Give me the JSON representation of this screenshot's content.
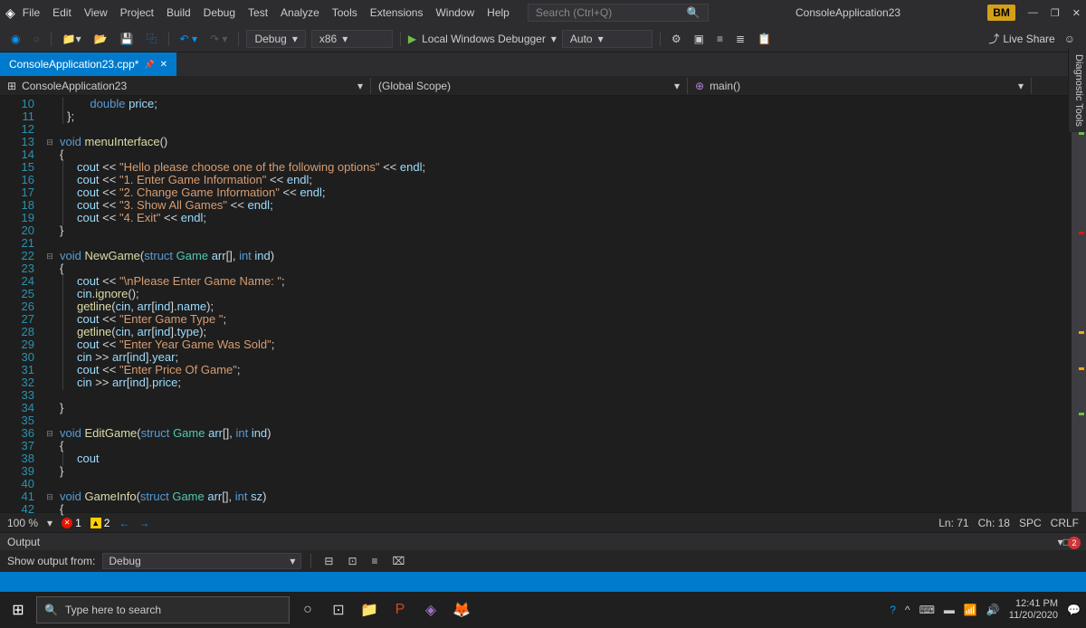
{
  "titlebar": {
    "menus": [
      "File",
      "Edit",
      "View",
      "Project",
      "Build",
      "Debug",
      "Test",
      "Analyze",
      "Tools",
      "Extensions",
      "Window",
      "Help"
    ],
    "search_placeholder": "Search (Ctrl+Q)",
    "title": "ConsoleApplication23",
    "user_badge": "BM"
  },
  "toolbar": {
    "config": "Debug",
    "platform": "x86",
    "start": "Local Windows Debugger",
    "threading": "Auto",
    "liveshare": "Live Share"
  },
  "tab": {
    "label": "ConsoleApplication23.cpp*"
  },
  "navbar": {
    "scope": "ConsoleApplication23",
    "scope2": "(Global Scope)",
    "scope3": "main()"
  },
  "line_start": 10,
  "line_end": 42,
  "editor_status": {
    "zoom": "100 %",
    "errors": "1",
    "warnings": "2",
    "ln": "Ln: 71",
    "ch": "Ch: 18",
    "ws": "SPC",
    "le": "CRLF"
  },
  "output": {
    "title": "Output",
    "from_label": "Show output from:",
    "from_value": "Debug"
  },
  "taskbar": {
    "search": "Type here to search",
    "time": "12:41 PM",
    "date": "11/20/2020"
  },
  "side_tool": "Diagnostic Tools",
  "notif": "2"
}
